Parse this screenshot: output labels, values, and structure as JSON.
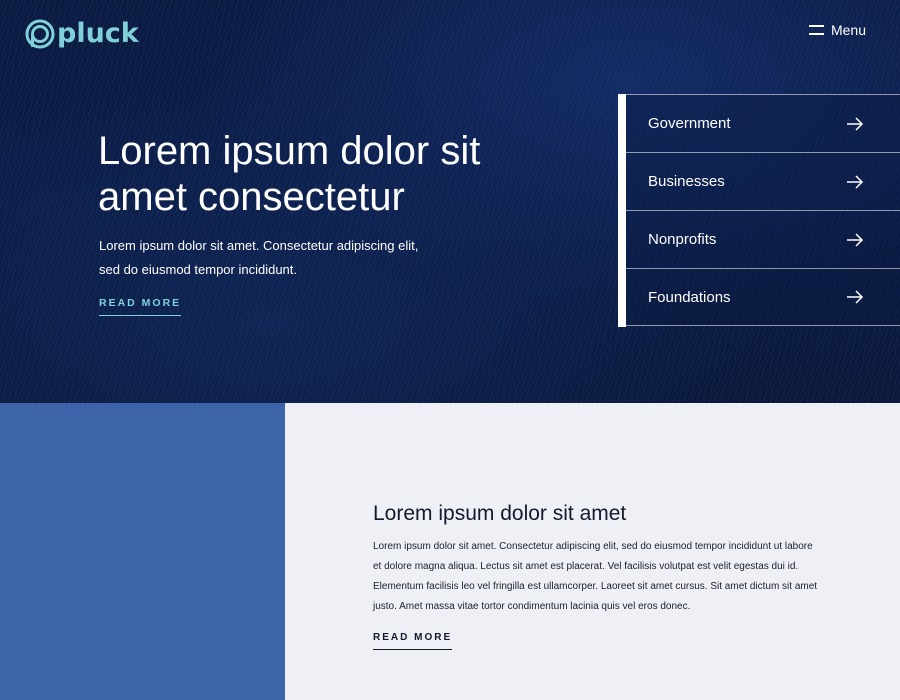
{
  "brand": {
    "name": "pluck",
    "accent_color": "#7fd0d8"
  },
  "header": {
    "menu_label": "Menu",
    "menu_icon": "hamburger-icon"
  },
  "hero": {
    "title": "Lorem ipsum dolor sit amet consectetur",
    "text": "Lorem ipsum dolor sit amet. Consectetur adipiscing elit, sed do eiusmod tempor incididunt.",
    "link_label": "READ MORE"
  },
  "categories": {
    "items": [
      {
        "label": "Government",
        "icon": "arrow-right-icon"
      },
      {
        "label": "Businesses",
        "icon": "arrow-right-icon"
      },
      {
        "label": "Nonprofits",
        "icon": "arrow-right-icon"
      },
      {
        "label": "Foundations",
        "icon": "arrow-right-icon"
      }
    ]
  },
  "section": {
    "panel_color": "#3d64a8",
    "title": "Lorem ipsum dolor sit amet",
    "text": "Lorem ipsum dolor sit amet. Consectetur adipiscing elit, sed do eiusmod tempor incididunt ut labore et dolore magna aliqua. Lectus sit amet est placerat. Vel facilisis volutpat est velit egestas dui id. Elementum facilisis leo vel fringilla est ullamcorper. Laoreet sit amet cursus. Sit amet dictum sit amet justo. Amet massa vitae tortor condimentum lacinia quis vel eros donec.",
    "link_label": "READ MORE"
  }
}
